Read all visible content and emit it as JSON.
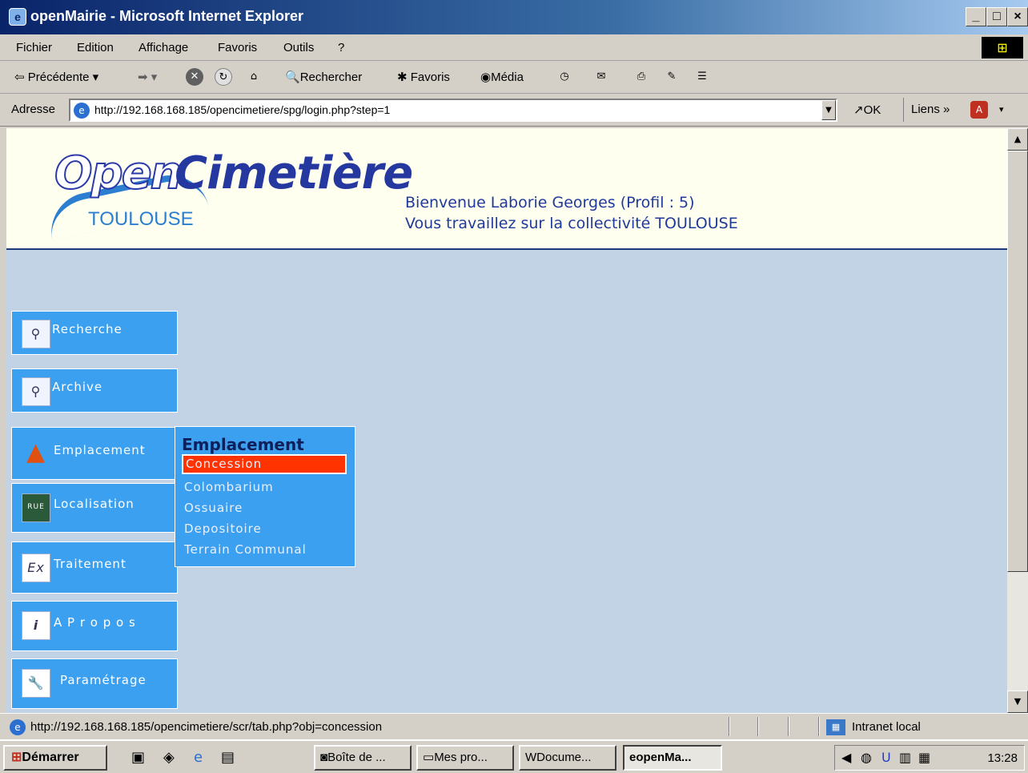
{
  "window": {
    "title": "openMairie - Microsoft Internet Explorer",
    "btn_minimize": "_",
    "btn_maximize": "□",
    "btn_close": "×"
  },
  "menubar": {
    "items": [
      "Fichier",
      "Edition",
      "Affichage",
      "Favoris",
      "Outils",
      "?"
    ]
  },
  "toolbar": {
    "back": "Précédente",
    "search": "Rechercher",
    "favorites": "Favoris",
    "media": "Média"
  },
  "addressbar": {
    "label": "Adresse",
    "url": "http://192.168.168.185/opencimetiere/spg/login.php?step=1",
    "go": "OK",
    "links": "Liens"
  },
  "header": {
    "logo_open": "Open",
    "logo_cimetiere": "Cimetière",
    "logo_city": "TOULOUSE",
    "welcome_line1": "Bienvenue Laborie Georges (Profil : 5)",
    "welcome_line2": "Vous travaillez sur la collectivité TOULOUSE"
  },
  "nav": {
    "items": [
      {
        "label": "Recherche",
        "icon": "magnifier-icon"
      },
      {
        "label": "Archive",
        "icon": "magnifier-icon"
      },
      {
        "label": "Emplacement",
        "icon": "pyramid-icon"
      },
      {
        "label": "Localisation",
        "icon": "street-sign-icon"
      },
      {
        "label": "Traitement",
        "icon": "ex-icon"
      },
      {
        "label": "A P r o p o s",
        "icon": "info-icon"
      },
      {
        "label": "Paramétrage",
        "icon": "wrench-icon"
      }
    ]
  },
  "submenu": {
    "title": "Emplacement",
    "items": [
      "Concession",
      "Colombarium",
      "Ossuaire",
      "Depositoire",
      "Terrain Communal"
    ]
  },
  "statusbar": {
    "url": "http://192.168.168.185/opencimetiere/scr/tab.php?obj=concession",
    "zone": "Intranet local"
  },
  "taskbar": {
    "start": "Démarrer",
    "tasks": [
      "Boîte de ...",
      "Mes pro...",
      "Docume...",
      "openMa..."
    ],
    "clock": "13:28"
  }
}
